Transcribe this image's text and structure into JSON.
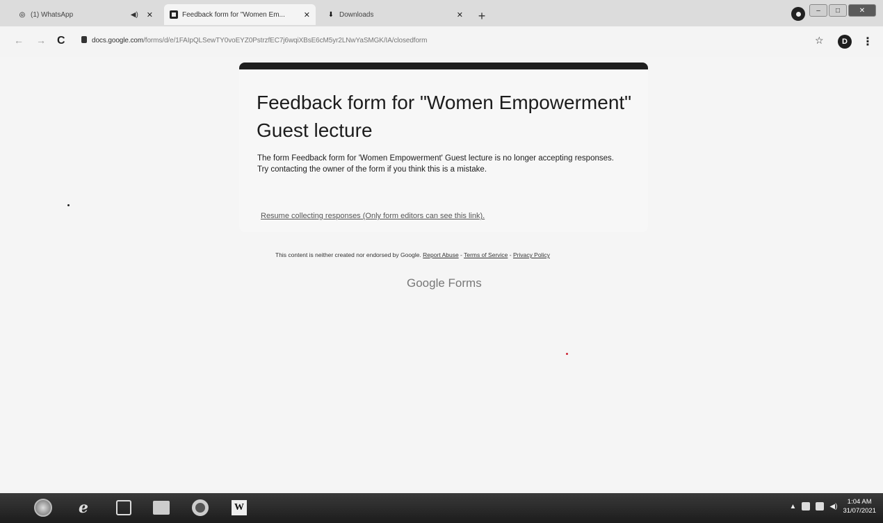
{
  "tabs": [
    {
      "title": "(1) WhatsApp",
      "active": false
    },
    {
      "title": "Feedback form for \"Women Em...",
      "active": true
    },
    {
      "title": "Downloads",
      "active": false
    }
  ],
  "address_bar": {
    "host": "docs.google.com",
    "path": "/forms/d/e/1FAIpQLSewTY0voEYZ0PstrzfEC7j6wqiXBsE6cM5yr2LNwYaSMGK/IA/closedform",
    "avatar_letter": "D"
  },
  "form": {
    "title": "Feedback form for \"Women Empowerment\" Guest lecture",
    "message_line1": "The form Feedback form for 'Women Empowerment' Guest lecture is no longer accepting responses.",
    "message_line2": "Try contacting the owner of the form if you think this is a mistake.",
    "resume_link": "Resume collecting responses (Only form editors can see this link)."
  },
  "footer": {
    "disclaimer": "This content is neither created nor endorsed by Google.",
    "report_abuse": "Report Abuse",
    "terms": "Terms of Service",
    "privacy": "Privacy Policy",
    "brand": "Google Forms"
  },
  "taskbar": {
    "time": "1:04 AM",
    "date": "31/07/2021",
    "word_label": "W"
  }
}
